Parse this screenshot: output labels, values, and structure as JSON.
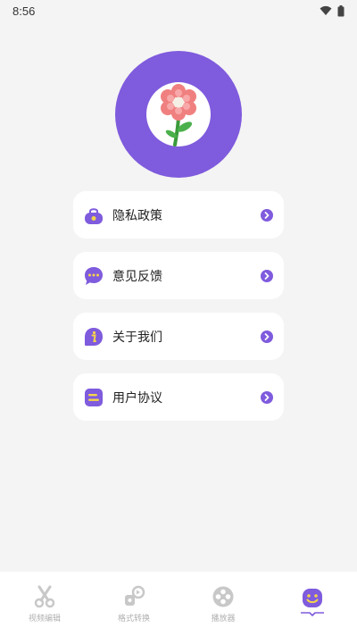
{
  "status": {
    "time": "8:56"
  },
  "menu": {
    "items": [
      {
        "label": "隐私政策",
        "icon": "lock-bag-icon"
      },
      {
        "label": "意见反馈",
        "icon": "chat-bubble-icon"
      },
      {
        "label": "关于我们",
        "icon": "info-icon"
      },
      {
        "label": "用户协议",
        "icon": "document-icon"
      }
    ]
  },
  "nav": {
    "items": [
      {
        "label": "视频编辑",
        "icon": "scissors-icon",
        "active": false
      },
      {
        "label": "格式转换",
        "icon": "convert-icon",
        "active": false
      },
      {
        "label": "播放器",
        "icon": "film-reel-icon",
        "active": false
      },
      {
        "label": "",
        "icon": "smile-icon",
        "active": true
      }
    ]
  },
  "colors": {
    "accent": "#7f5bdd",
    "background": "#f4f4f4",
    "card": "#ffffff",
    "nav_inactive": "#b0b0b0"
  }
}
